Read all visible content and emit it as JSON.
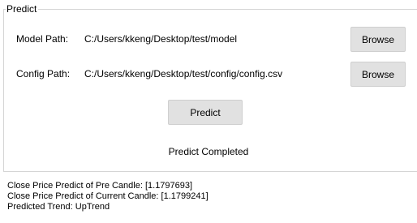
{
  "group": {
    "title": "Predict"
  },
  "model": {
    "label": "Model Path:",
    "path": "C:/Users/kkeng/Desktop/test/model",
    "browse_label": "Browse"
  },
  "config": {
    "label": "Config Path:",
    "path": "C:/Users/kkeng/Desktop/test/config/config.csv",
    "browse_label": "Browse"
  },
  "predict_button": "Predict",
  "status": "Predict Completed",
  "results": [
    "Close Price Predict of Pre Candle: [1.1797693]",
    "Close Price Predict of Current Candle: [1.1799241]",
    "Predicted Trend: UpTrend"
  ]
}
